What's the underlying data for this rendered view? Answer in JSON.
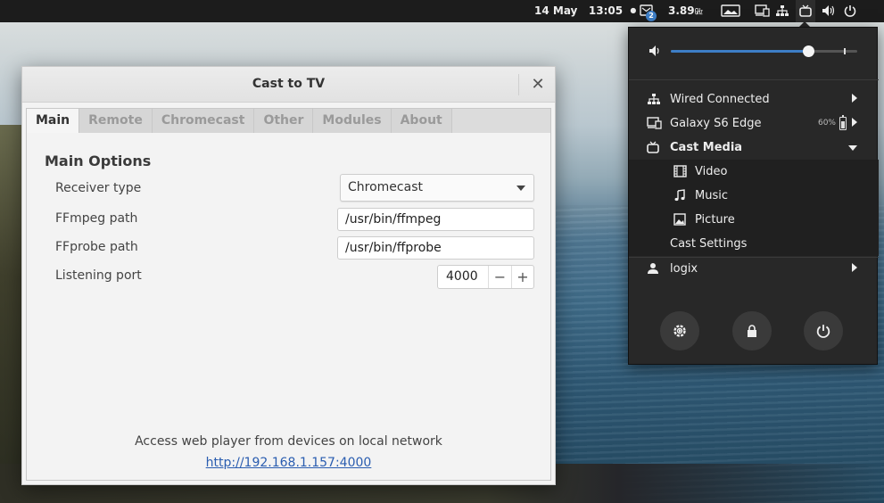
{
  "topbar": {
    "date": "14 May",
    "time": "13:05",
    "notification_dot": "●",
    "messages_badge": "2",
    "net_speed_value": "3.89",
    "net_speed_unit": "㎓"
  },
  "window": {
    "title": "Cast to TV",
    "close_glyph": "✕",
    "tabs": [
      {
        "label": "Main",
        "active": true
      },
      {
        "label": "Remote",
        "active": false
      },
      {
        "label": "Chromecast",
        "active": false
      },
      {
        "label": "Other",
        "active": false
      },
      {
        "label": "Modules",
        "active": false
      },
      {
        "label": "About",
        "active": false
      }
    ],
    "section_title": "Main Options",
    "fields": {
      "receiver_type_label": "Receiver type",
      "receiver_type_value": "Chromecast",
      "ffmpeg_label": "FFmpeg path",
      "ffmpeg_value": "/usr/bin/ffmpeg",
      "ffprobe_label": "FFprobe path",
      "ffprobe_value": "/usr/bin/ffprobe",
      "port_label": "Listening port",
      "port_value": "4000",
      "port_minus": "−",
      "port_plus": "+"
    },
    "footer_text": "Access web player from devices on local network",
    "footer_link": "http://192.168.1.157:4000"
  },
  "menu": {
    "volume_level": 0.74,
    "volume_max_mark": 0.93,
    "items": {
      "wired": "Wired Connected",
      "device": "Galaxy S6 Edge",
      "battery_pct": "60%",
      "cast_media": "Cast Media",
      "video": "Video",
      "music": "Music",
      "picture": "Picture",
      "cast_settings": "Cast Settings",
      "user": "logix"
    },
    "accent": "#3d7ec6"
  }
}
